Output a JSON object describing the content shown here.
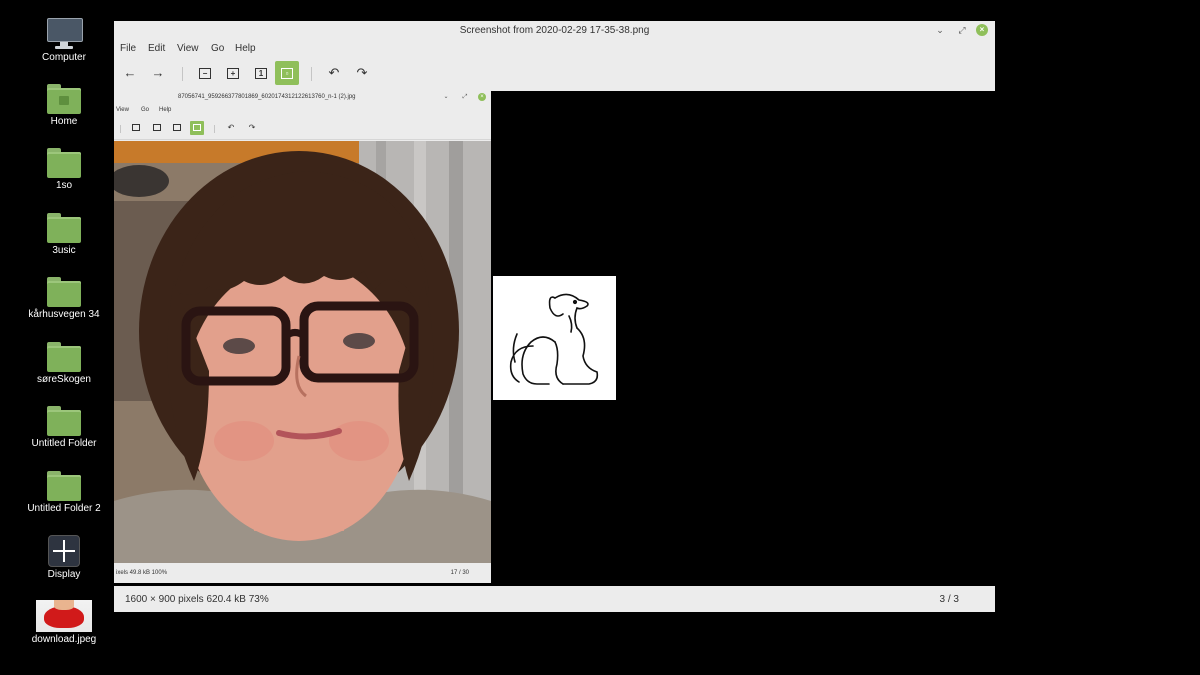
{
  "desktop": {
    "icons": [
      {
        "label": "Computer",
        "icon": "computer-icon"
      },
      {
        "label": "Home",
        "icon": "home-folder-icon"
      },
      {
        "label": "1so",
        "icon": "folder-icon"
      },
      {
        "label": "3usic",
        "icon": "folder-icon"
      },
      {
        "label": "kårhusvegen 34",
        "icon": "folder-icon"
      },
      {
        "label": "søreSkogen",
        "icon": "folder-icon"
      },
      {
        "label": "Untitled Folder",
        "icon": "folder-icon"
      },
      {
        "label": "Untitled Folder 2",
        "icon": "folder-icon"
      },
      {
        "label": "Display",
        "icon": "display-settings-icon"
      },
      {
        "label": "download.jpeg",
        "icon": "image-thumbnail"
      }
    ]
  },
  "viewer": {
    "title": "Screenshot from 2020-02-29 17-35-38.png",
    "menu": [
      "File",
      "Edit",
      "View",
      "Go",
      "Help"
    ],
    "status_left": "1600 × 900 pixels   620.4 kB   73%",
    "status_right": "3 / 3",
    "accent": "#8fbf5a"
  },
  "inner": {
    "title": "87056741_959266377801869_6020174312122613760_n-1 (2).jpg",
    "menu": [
      "View",
      "Go",
      "Help"
    ],
    "status_left": "ixels   49.8 kB   100%",
    "status_right": "17 / 30"
  }
}
